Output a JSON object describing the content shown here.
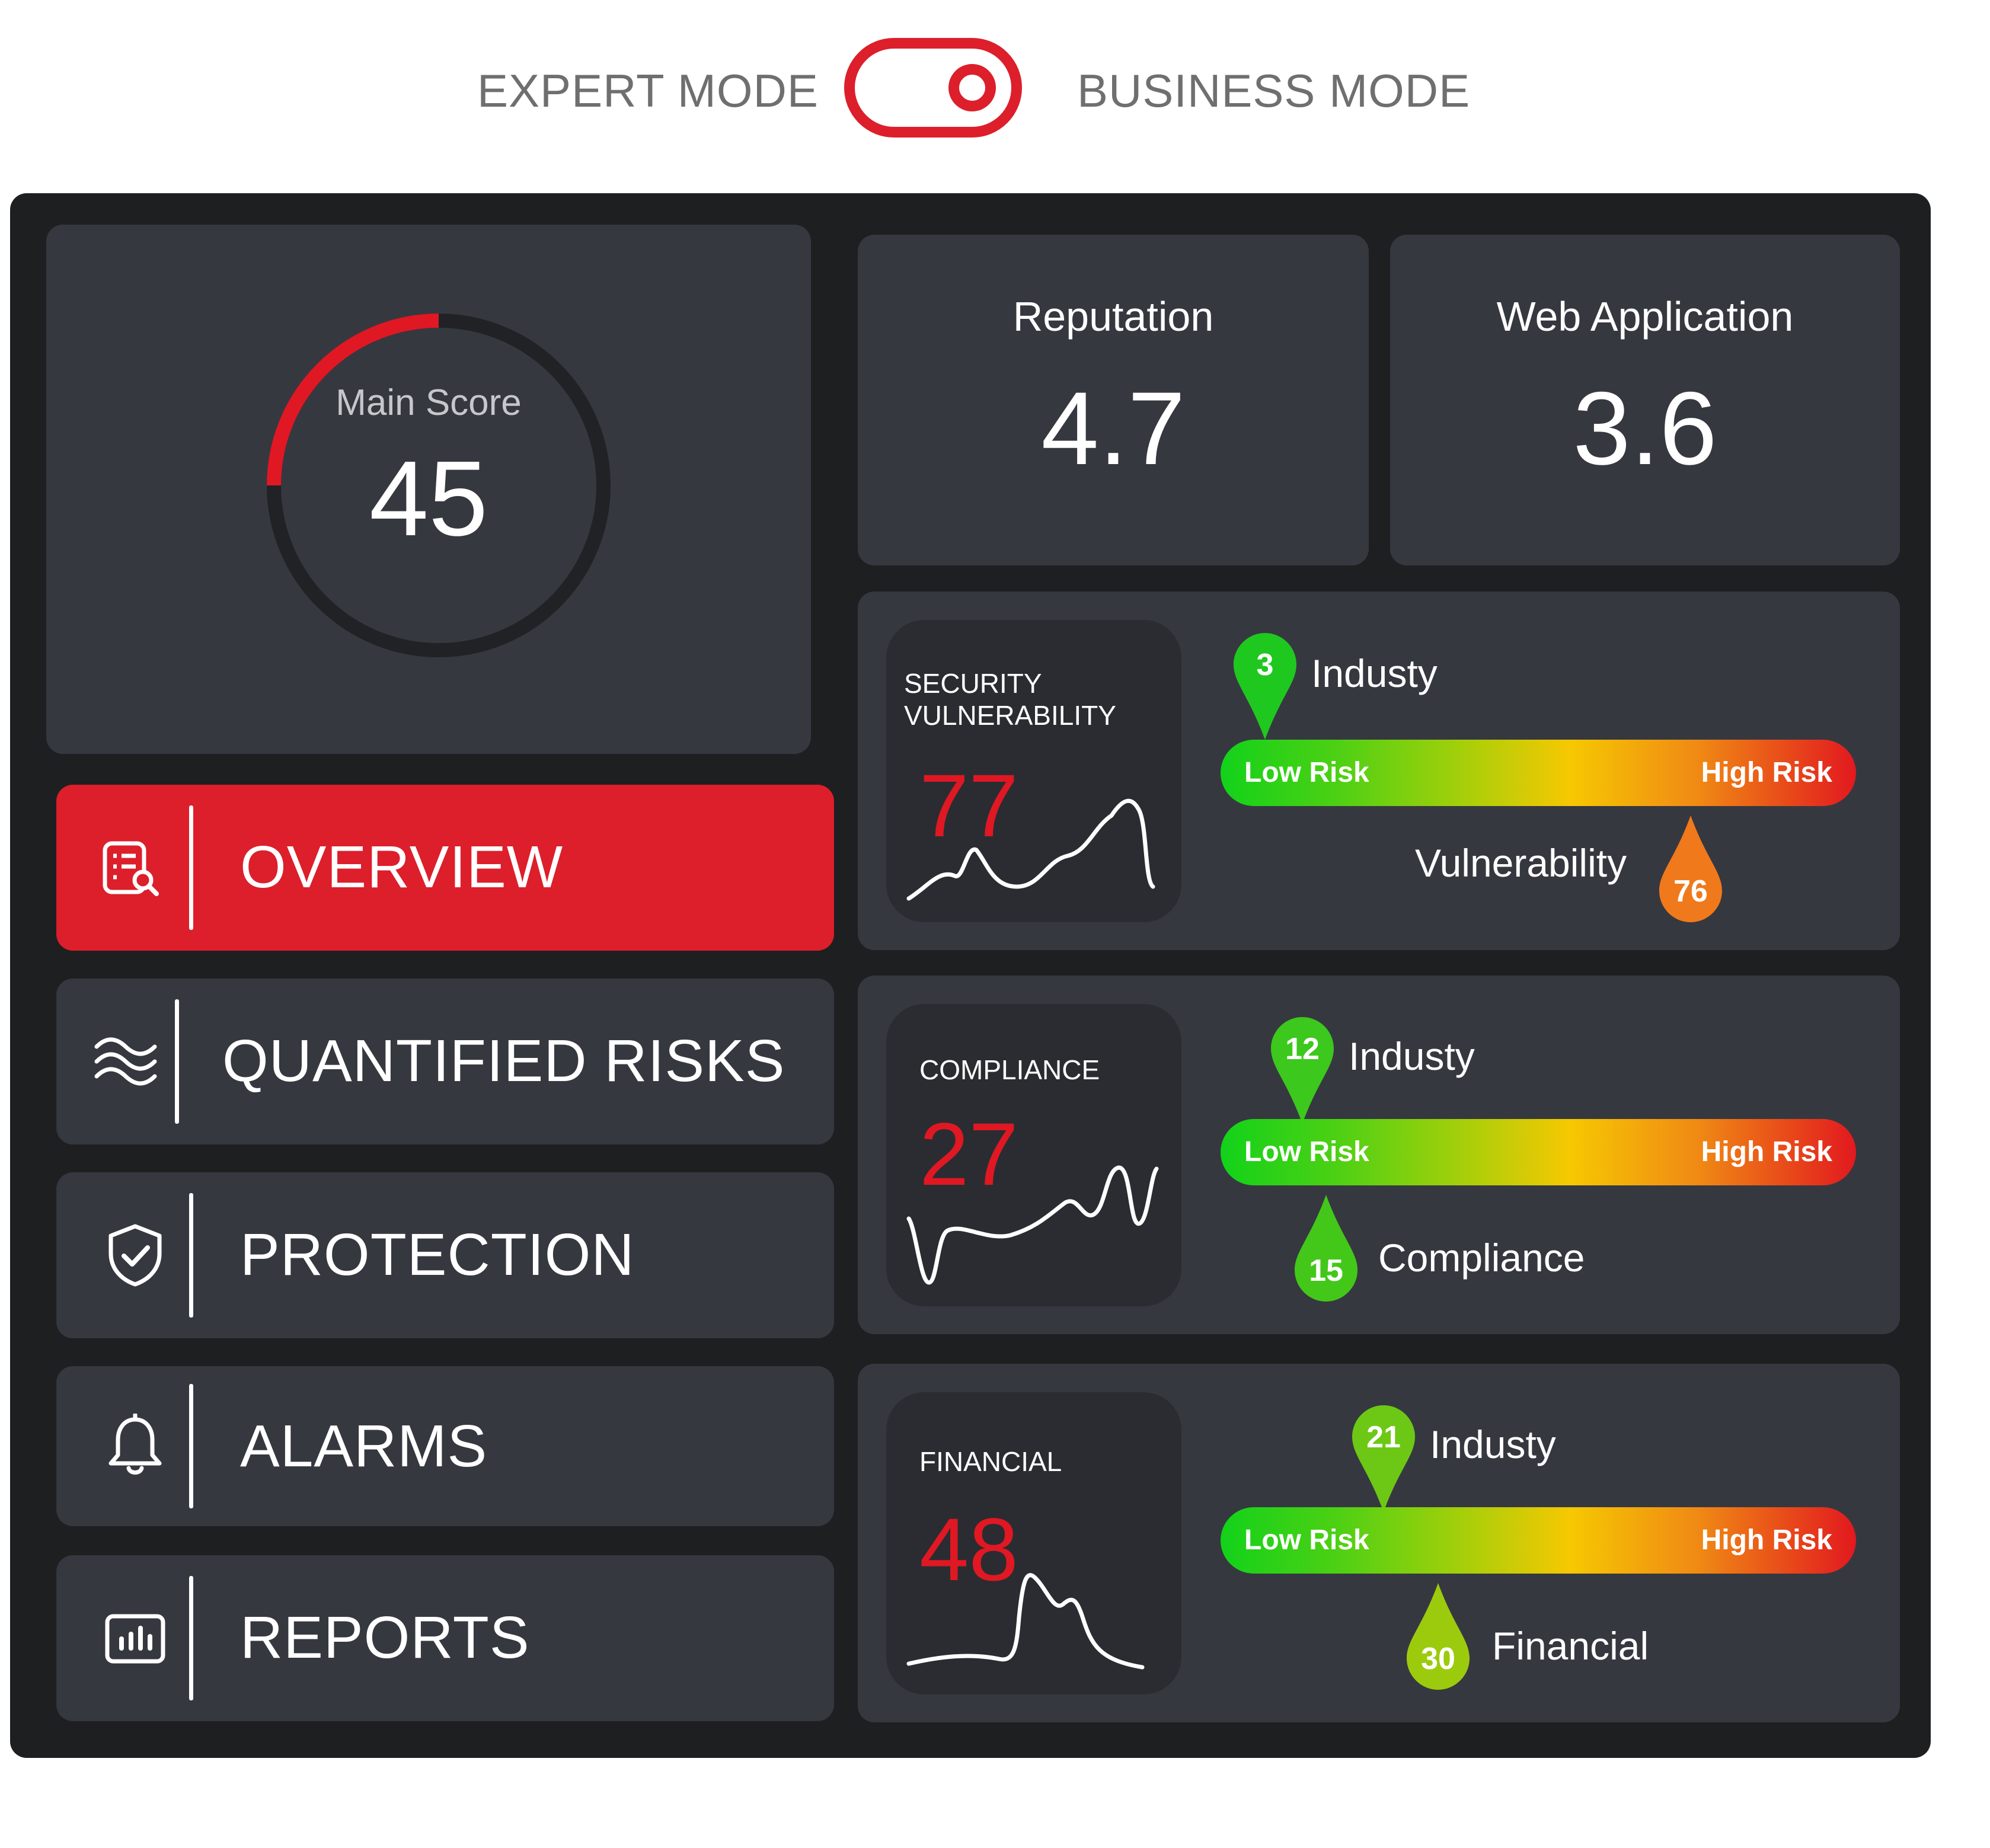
{
  "mode_toggle": {
    "left_label": "EXPERT MODE",
    "right_label": "BUSINESS MODE",
    "accent": "#dc1f2b"
  },
  "main_score": {
    "label": "Main Score",
    "value": "45",
    "progress_fraction": 0.25
  },
  "nav": {
    "items": [
      {
        "label": "OVERVIEW",
        "icon": "report-search-icon",
        "active": true
      },
      {
        "label": "QUANTIFIED RISKS",
        "icon": "waves-icon",
        "active": false
      },
      {
        "label": "PROTECTION",
        "icon": "shield-check-icon",
        "active": false
      },
      {
        "label": "ALARMS",
        "icon": "bell-icon",
        "active": false
      },
      {
        "label": "REPORTS",
        "icon": "bar-chart-icon",
        "active": false
      }
    ]
  },
  "metrics": {
    "reputation": {
      "title": "Reputation",
      "value": "4.7"
    },
    "web_application": {
      "title": "Web Application",
      "value": "3.6"
    }
  },
  "risk_bar": {
    "low_label": "Low Risk",
    "high_label": "High Risk"
  },
  "risks": [
    {
      "title": "SECURITY\nVULNERABILITY",
      "score": "77",
      "industry": {
        "value": "3",
        "label": "Industy",
        "color": "#1fc81f"
      },
      "marker": {
        "value": "76",
        "label": "Vulnerability",
        "color": "#f0791b"
      }
    },
    {
      "title": "COMPLIANCE",
      "score": "27",
      "industry": {
        "value": "12",
        "label": "Industy",
        "color": "#3cc81c"
      },
      "marker": {
        "value": "15",
        "label": "Compliance",
        "color": "#43c81a"
      }
    },
    {
      "title": "FINANCIAL",
      "score": "48",
      "industry": {
        "value": "21",
        "label": "Industy",
        "color": "#6dc815"
      },
      "marker": {
        "value": "30",
        "label": "Financial",
        "color": "#9ccb0d"
      }
    }
  ]
}
